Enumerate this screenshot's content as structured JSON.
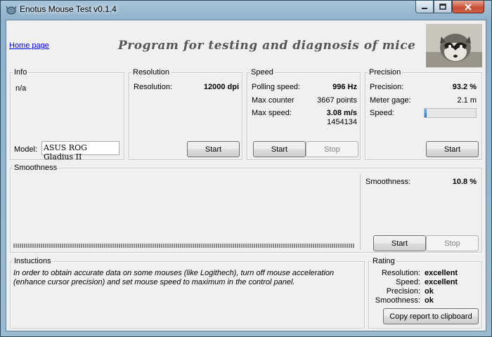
{
  "window": {
    "title": "Enotus Mouse Test v0.1.4",
    "controls": {
      "minimize": "minimize-icon",
      "maximize": "maximize-icon",
      "close": "close-icon"
    }
  },
  "header": {
    "home_link": "Home page",
    "title": "Program for testing and diagnosis of mice"
  },
  "info": {
    "title": "Info",
    "status": "n/a",
    "model_label": "Model:",
    "model_value": "ASUS ROG Gladius II"
  },
  "resolution": {
    "title": "Resolution",
    "label": "Resolution:",
    "value": "12000 dpi",
    "start": "Start"
  },
  "speed": {
    "title": "Speed",
    "polling_label": "Polling speed:",
    "polling_value": "996 Hz",
    "counter_label": "Max counter",
    "counter_value": "3667 points",
    "max_label": "Max  speed:",
    "max_value": "3.08 m/s",
    "max_sub": "1454134",
    "start": "Start",
    "stop": "Stop"
  },
  "precision": {
    "title": "Precision",
    "precision_label": "Precision:",
    "precision_value": "93.2 %",
    "gage_label": "Meter gage:",
    "gage_value": "2.1 m",
    "speed_label": "Speed:",
    "speed_level": 0.04,
    "start": "Start"
  },
  "smoothness": {
    "title": "Smoothness",
    "label": "Smoothness:",
    "value": "10.8 %",
    "start": "Start",
    "stop": "Stop"
  },
  "instructions": {
    "title": "Instuctions",
    "text": "In order to obtain accurate data on some mouses (like Logithech), turn off mouse acceleration (enhance cursor precision) and set mouse speed to maximum in the control panel."
  },
  "rating": {
    "title": "Rating",
    "rows": [
      {
        "label": "Resolution:",
        "value": "excellent"
      },
      {
        "label": "Speed:",
        "value": "excellent"
      },
      {
        "label": "Precision:",
        "value": "ok"
      },
      {
        "label": "Smoothness:",
        "value": "ok"
      }
    ],
    "copy": "Copy report to clipboard"
  }
}
